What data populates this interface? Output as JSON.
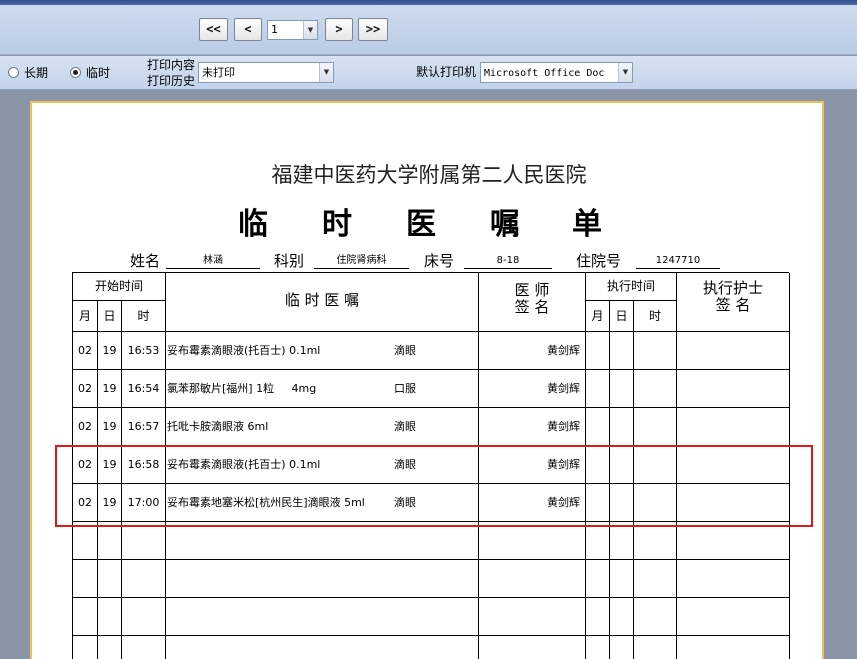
{
  "toolbar": {
    "first_label": "<<",
    "prev_label": "<",
    "page_value": "1",
    "next_label": ">",
    "last_label": ">>"
  },
  "options": {
    "long_term_label": "长期",
    "temporary_label": "临时",
    "selected": "临时",
    "print_content_label": "打印内容",
    "print_history_label": "打印历史",
    "print_filter_value": "未打印",
    "default_printer_label": "默认打印机",
    "printer_value": "Microsoft Office Doc"
  },
  "document": {
    "hospital": "福建中医药大学附属第二人民医院",
    "title_chars": [
      "临",
      "时",
      "医",
      "嘱",
      "单"
    ],
    "patient": {
      "name_label": "姓名",
      "name": "林涵",
      "dept_label": "科别",
      "dept": "住院肾病科",
      "bed_label": "床号",
      "bed": "8-18",
      "admission_label": "住院号",
      "admission": "1247710"
    },
    "headers": {
      "start_time": "开始时间",
      "month": "月",
      "day": "日",
      "time": "时",
      "order": "临 时 医 嘱",
      "doctor_sign_line1": "医 师",
      "doctor_sign_line2": "签 名",
      "exec_time": "执行时间",
      "nurse_line1": "执行护士",
      "nurse_line2": "签  名"
    },
    "orders": [
      {
        "month": "02",
        "day": "19",
        "time": "16:53",
        "drug": "妥布霉素滴眼液(托百士) 0.1ml",
        "route": "滴眼",
        "doctor": "黄剑辉"
      },
      {
        "month": "02",
        "day": "19",
        "time": "16:54",
        "drug": "氯苯那敏片[福州] 1粒     4mg",
        "route": "口服",
        "doctor": "黄剑辉"
      },
      {
        "month": "02",
        "day": "19",
        "time": "16:57",
        "drug": "托吡卡胺滴眼液 6ml",
        "route": "滴眼",
        "doctor": "黄剑辉"
      },
      {
        "month": "02",
        "day": "19",
        "time": "16:58",
        "drug": "妥布霉素滴眼液(托百士) 0.1ml",
        "route": "滴眼",
        "doctor": "黄剑辉"
      },
      {
        "month": "02",
        "day": "19",
        "time": "17:00",
        "drug": "妥布霉素地塞米松[杭州民生]滴眼液 5ml",
        "route": "滴眼",
        "doctor": "黄剑辉"
      }
    ]
  },
  "colors": {
    "highlight": "#e01818",
    "paper_border": "#f0c050",
    "workspace": "#8a96a8"
  }
}
